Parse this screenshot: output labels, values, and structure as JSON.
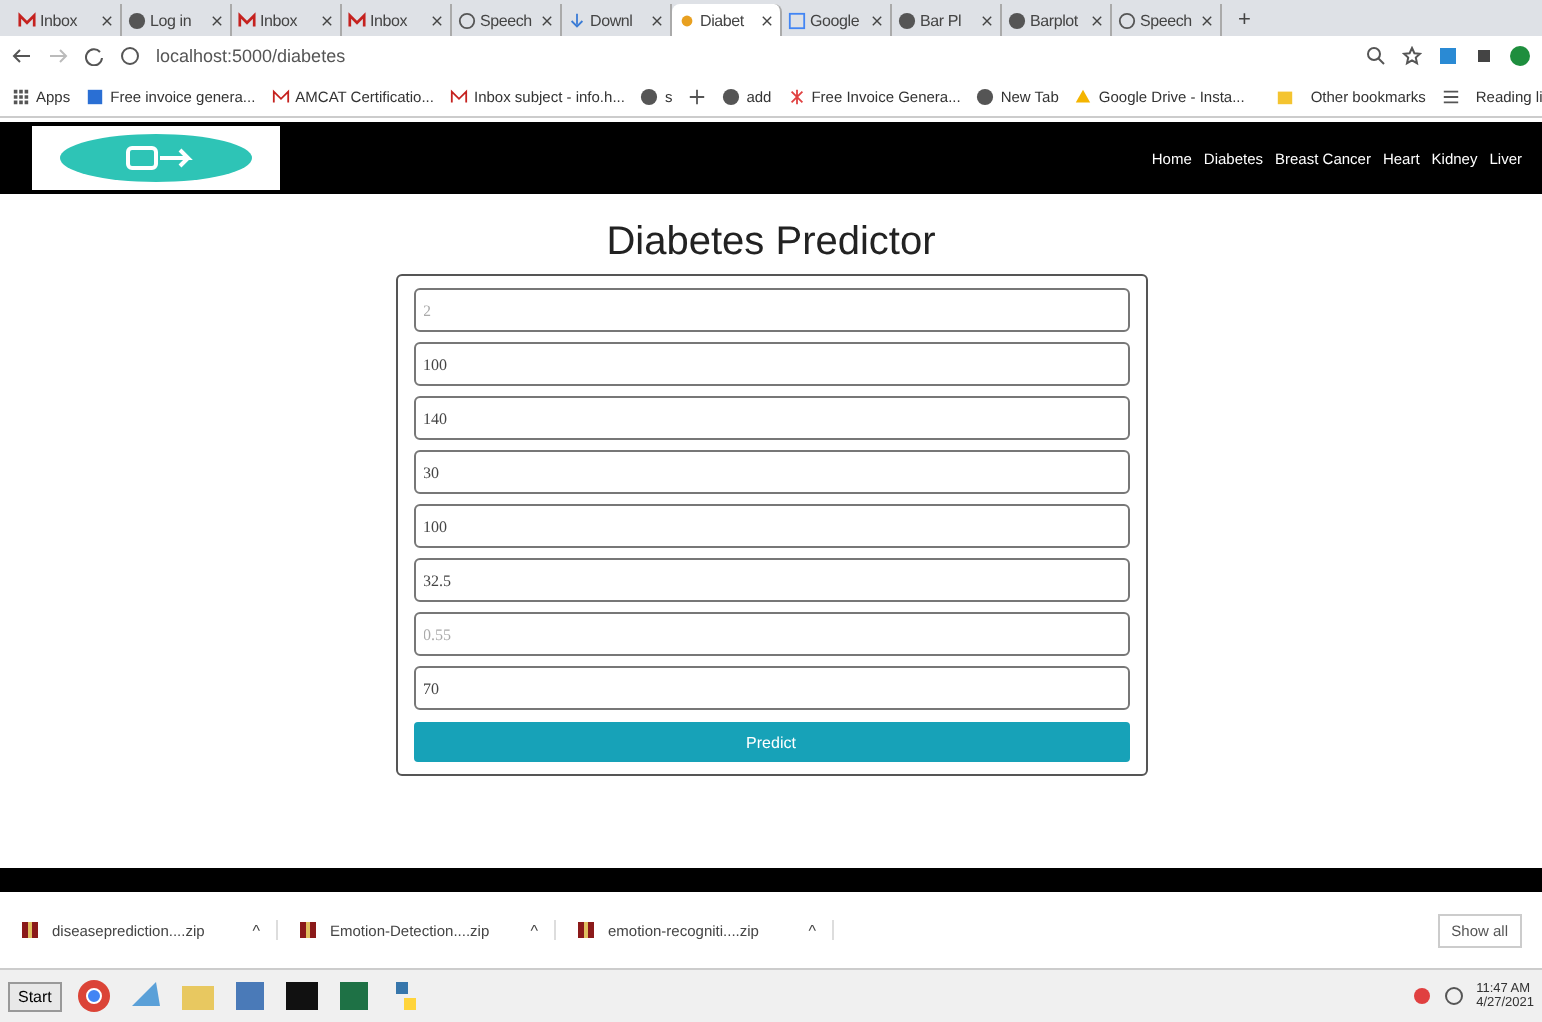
{
  "browser": {
    "tabs": [
      {
        "label": "Inbox",
        "selected": false,
        "kind": "mail"
      },
      {
        "label": "Log in",
        "selected": false,
        "kind": "globe"
      },
      {
        "label": "Inbox",
        "selected": false,
        "kind": "mail"
      },
      {
        "label": "Inbox",
        "selected": false,
        "kind": "mail"
      },
      {
        "label": "Speech",
        "selected": false,
        "kind": "dial"
      },
      {
        "label": "Downl",
        "selected": false,
        "kind": "download"
      },
      {
        "label": "Diabet",
        "selected": true,
        "kind": "dot"
      },
      {
        "label": "Google",
        "selected": false,
        "kind": "g"
      },
      {
        "label": "Bar Pl",
        "selected": false,
        "kind": "globe"
      },
      {
        "label": "Barplot",
        "selected": false,
        "kind": "globe"
      },
      {
        "label": "Speech",
        "selected": false,
        "kind": "dial"
      }
    ],
    "new_tab": "+",
    "url": "localhost:5000/diabetes",
    "bookmarks": [
      {
        "label": "Apps",
        "kind": "grid"
      },
      {
        "label": "Free invoice genera...",
        "kind": "square"
      },
      {
        "label": "AMCAT Certificatio...",
        "kind": "mail"
      },
      {
        "label": "Inbox subject - info.h...",
        "kind": "mail"
      },
      {
        "label": "s",
        "kind": "globe"
      },
      {
        "kind": "plus"
      },
      {
        "label": "add",
        "kind": "globe"
      },
      {
        "label": "Free Invoice Genera...",
        "kind": "star"
      },
      {
        "label": "New Tab",
        "kind": "globe"
      },
      {
        "label": "Google Drive - Insta...",
        "kind": "drive"
      }
    ],
    "other_bookmarks": "Other bookmarks",
    "reading_list": "Reading li"
  },
  "navbar": {
    "links": [
      "Home",
      "Diabetes",
      "Breast Cancer",
      "Heart",
      "Kidney",
      "Liver"
    ]
  },
  "page": {
    "title": "Diabetes Predictor",
    "fields": [
      {
        "placeholder": "2"
      },
      {
        "value": "100"
      },
      {
        "value": "140"
      },
      {
        "value": "30"
      },
      {
        "value": "100"
      },
      {
        "value": "32.5"
      },
      {
        "placeholder": "0.55"
      },
      {
        "value": "70"
      }
    ],
    "button": "Predict"
  },
  "downloads": {
    "items": [
      "diseaseprediction....zip",
      "Emotion-Detection....zip",
      "emotion-recogniti....zip"
    ],
    "expand": "^",
    "show_all": "Show all"
  },
  "taskbar": {
    "start": "Start",
    "time": "11:47 AM",
    "date": "4/27/2021"
  }
}
